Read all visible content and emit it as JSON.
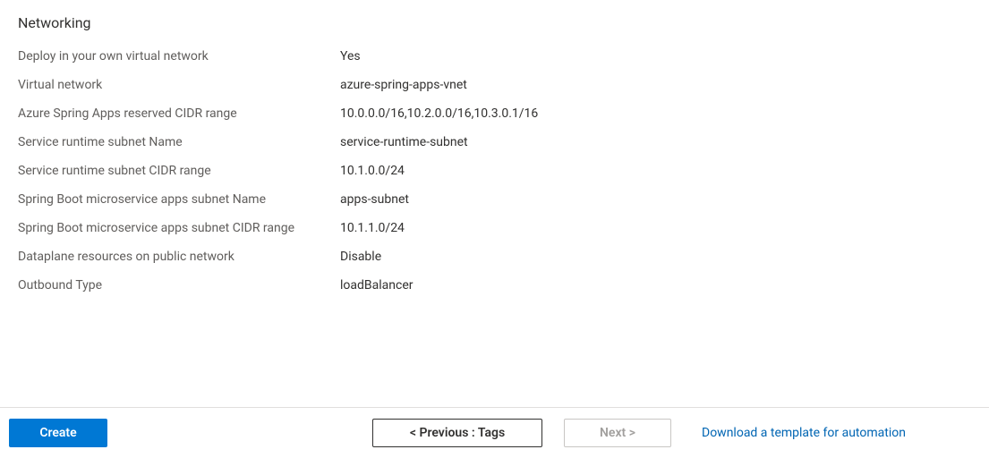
{
  "section": {
    "title": "Networking"
  },
  "rows": {
    "deploy_vnet": {
      "label": "Deploy in your own virtual network",
      "value": "Yes"
    },
    "vnet": {
      "label": "Virtual network",
      "value": "azure-spring-apps-vnet"
    },
    "cidr_range": {
      "label": "Azure Spring Apps reserved CIDR range",
      "value": "10.0.0.0/16,10.2.0.0/16,10.3.0.1/16"
    },
    "runtime_subnet_name": {
      "label": "Service runtime subnet Name",
      "value": "service-runtime-subnet"
    },
    "runtime_subnet_cidr": {
      "label": "Service runtime subnet CIDR range",
      "value": "10.1.0.0/24"
    },
    "apps_subnet_name": {
      "label": "Spring Boot microservice apps subnet Name",
      "value": "apps-subnet"
    },
    "apps_subnet_cidr": {
      "label": "Spring Boot microservice apps subnet CIDR range",
      "value": "10.1.1.0/24"
    },
    "dataplane": {
      "label": "Dataplane resources on public network",
      "value": "Disable"
    },
    "outbound": {
      "label": "Outbound Type",
      "value": "loadBalancer"
    }
  },
  "footer": {
    "create": "Create",
    "previous": "< Previous : Tags",
    "next": "Next >",
    "download": "Download a template for automation"
  }
}
